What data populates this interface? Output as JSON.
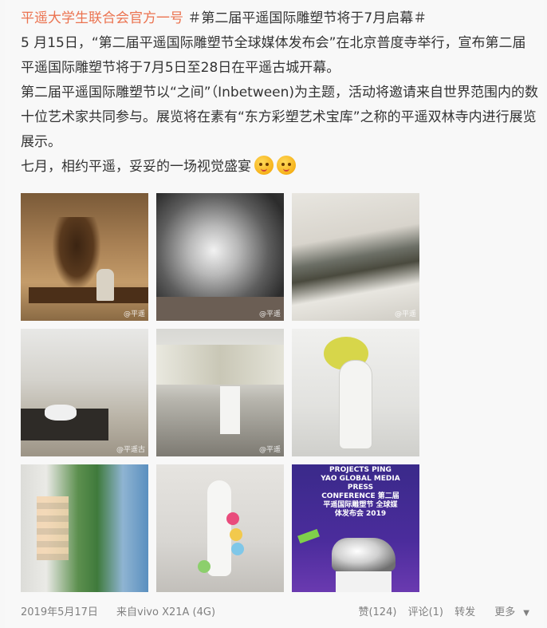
{
  "post": {
    "author": "平遥大学生联合会官方一号",
    "hashtag": "＃第二届平遥国际雕塑节将于7月启幕＃",
    "paragraph1": "5 月15日，“第二届平遥国际雕塑节全球媒体发布会”在北京普度寺举行，宣布第二届平遥国际雕塑节将于7月5日至28日在平遥古城开幕。",
    "paragraph2": "第二届平遥国际雕塑节以“之间”（Inbetween)为主题，活动将邀请来自世界范围内的数十位艺术家共同参与。展览将在素有“东方彩塑艺术宝库”之称的平遥双林寺内进行展览展示。",
    "paragraph3": "七月，相约平遥，妥妥的一场视觉盛宴",
    "emoji": [
      "smiley-icon",
      "smiley-icon"
    ]
  },
  "images": [
    {
      "name": "wooden-sculpture-photo",
      "watermark": "@平遥"
    },
    {
      "name": "silver-rock-sculpture-photo",
      "watermark": "@平遥"
    },
    {
      "name": "landscape-relief-photo",
      "watermark": "@平遥"
    },
    {
      "name": "gallery-display-cases-photo",
      "watermark": "@平遥古"
    },
    {
      "name": "scroll-installation-photo",
      "watermark": "@平遥"
    },
    {
      "name": "white-figure-sculpture-photo",
      "watermark": ""
    },
    {
      "name": "glass-panels-photo",
      "watermark": ""
    },
    {
      "name": "figure-with-balloons-photo",
      "watermark": ""
    },
    {
      "name": "press-conference-rhino-photo",
      "watermark": "",
      "banner": "PROJECTS PING YAO GLOBAL MEDIA PRESS CONFERENCE 第二届平遥国际雕塑节 全球媒体发布会 2019"
    }
  ],
  "footer": {
    "date": "2019年5月17日",
    "device": "来自vivo X21A (4G)",
    "like": "赞(124)",
    "comment": "评论(1)",
    "repost": "转发",
    "more": "更多",
    "more_arrow": "▼"
  }
}
